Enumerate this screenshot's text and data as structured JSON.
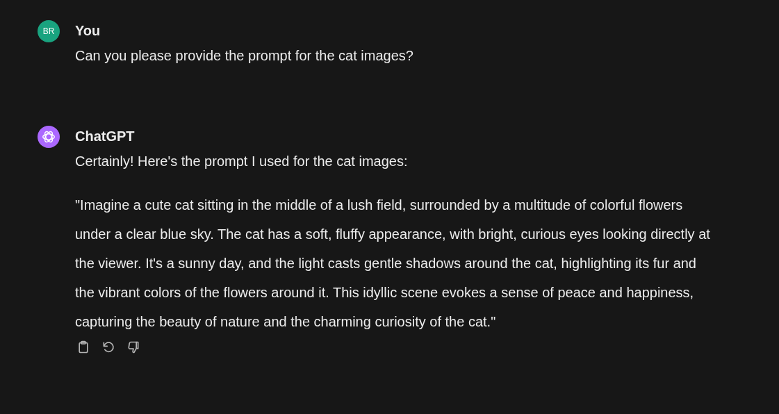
{
  "messages": [
    {
      "kind": "user",
      "author": "You",
      "avatar_initials": "BR",
      "color": "#19a37f",
      "paragraphs": [
        "Can you please provide the prompt for the cat images?"
      ]
    },
    {
      "kind": "assistant",
      "author": "ChatGPT",
      "color": "#ab68ff",
      "paragraphs": [
        "Certainly! Here's the prompt I used for the cat images:",
        "\"Imagine a cute cat sitting in the middle of a lush field, surrounded by a multitude of colorful flowers under a clear blue sky. The cat has a soft, fluffy appearance, with bright, curious eyes looking directly at the viewer. It's a sunny day, and the light casts gentle shadows around the cat, highlighting its fur and the vibrant colors of the flowers around it. This idyllic scene evokes a sense of peace and happiness, capturing the beauty of nature and the charming curiosity of the cat.\""
      ],
      "actions": [
        {
          "kind": "copy"
        },
        {
          "kind": "regenerate"
        },
        {
          "kind": "dislike"
        }
      ]
    }
  ]
}
